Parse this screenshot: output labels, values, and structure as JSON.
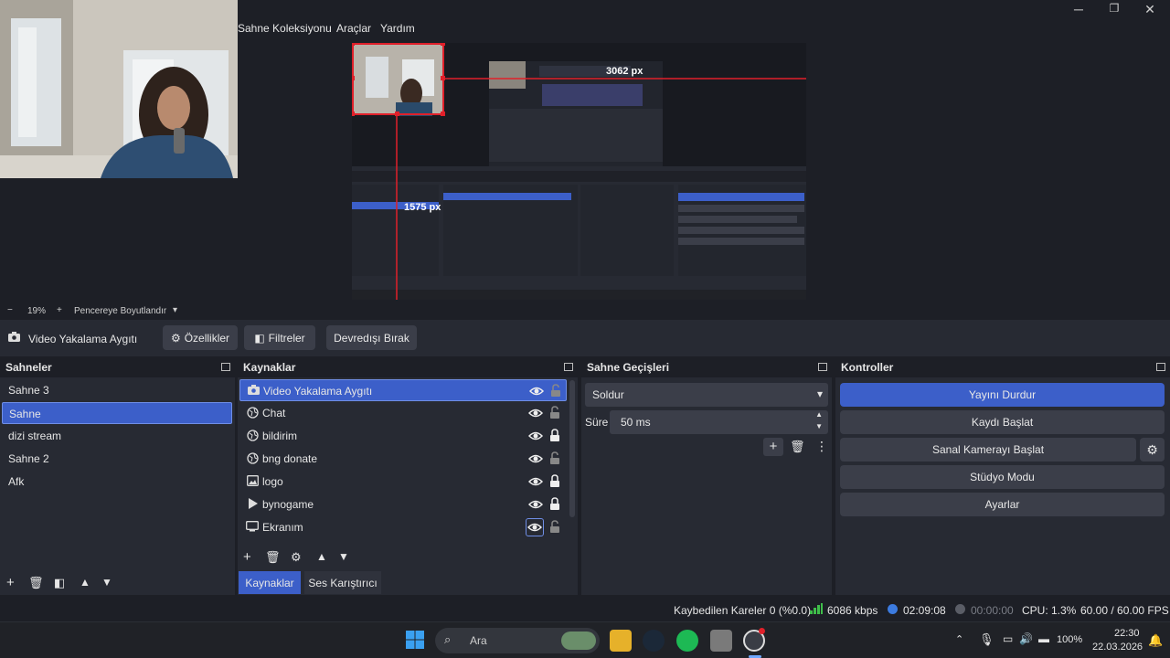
{
  "menu": {
    "items": [
      "Sahne Koleksiyonu",
      "Araçlar",
      "Yardım"
    ]
  },
  "window": {
    "minimize": "─",
    "maximize": "❐",
    "close": "✕"
  },
  "preview": {
    "px_label_1": "3062 px",
    "px_label_2": "1575 px"
  },
  "zoombar": {
    "minus": "−",
    "zoom": "19%",
    "plus": "+",
    "mode": "Pencereye Boyutlandır"
  },
  "source_toolbar": {
    "source_name": "Video Yakalama Aygıtı",
    "properties_label": "Özellikler",
    "filters_label": "Filtreler",
    "deactivate_label": "Devredışı Bırak"
  },
  "scenes": {
    "title": "Sahneler",
    "items": [
      "Sahne 3",
      "Sahne",
      "dizi stream",
      "Sahne 2",
      "Afk"
    ],
    "selected": "Sahne"
  },
  "sources": {
    "title": "Kaynaklar",
    "items": [
      {
        "name": "Video Yakalama Aygıtı",
        "icon": "camera-icon",
        "locked": false
      },
      {
        "name": "Chat",
        "icon": "globe-icon",
        "locked": false
      },
      {
        "name": "bildirim",
        "icon": "globe-icon",
        "locked": true
      },
      {
        "name": "bng donate",
        "icon": "globe-icon",
        "locked": false
      },
      {
        "name": "logo",
        "icon": "image-icon",
        "locked": true
      },
      {
        "name": "bynogame",
        "icon": "play-icon",
        "locked": true
      },
      {
        "name": "Ekranım",
        "icon": "monitor-icon",
        "locked": false
      }
    ],
    "tabs": [
      "Kaynaklar",
      "Ses Karıştırıcı"
    ]
  },
  "transitions": {
    "title": "Sahne Geçişleri",
    "selected": "Soldur",
    "duration_label": "Süre",
    "duration_value": "50 ms"
  },
  "controls": {
    "title": "Kontroller",
    "stop_stream": "Yayını Durdur",
    "start_recording": "Kaydı Başlat",
    "start_virtual_cam": "Sanal Kamerayı Başlat",
    "studio_mode": "Stüdyo Modu",
    "settings": "Ayarlar"
  },
  "status": {
    "dropped_frames": "Kaybedilen Kareler 0 (%0.0)",
    "bitrate": "6086 kbps",
    "stream_time": "02:09:08",
    "record_time": "00:00:00",
    "cpu": "CPU: 1.3%",
    "fps": "60.00 / 60.00 FPS"
  },
  "taskbar": {
    "search_placeholder": "Ara",
    "battery": "100%",
    "time": "22:30",
    "date": "22.03.2026"
  },
  "colors": {
    "accent": "#3c5fc9",
    "panel": "#272a33",
    "bg": "#1d1f26",
    "button": "#3b3e49"
  }
}
